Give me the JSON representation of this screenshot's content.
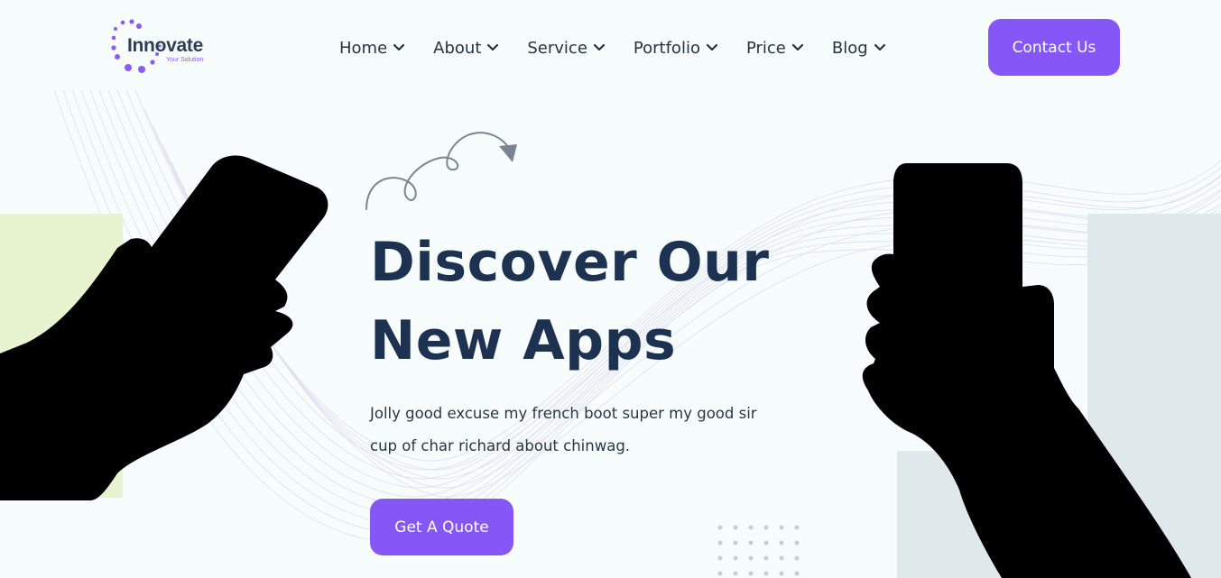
{
  "brand": {
    "name": "Innovate",
    "tagline": "Your Solution",
    "accent_color": "#8557f6"
  },
  "nav": {
    "items": [
      {
        "label": "Home",
        "icon": "chevron-down-icon"
      },
      {
        "label": "About",
        "icon": "chevron-down-icon"
      },
      {
        "label": "Service",
        "icon": "chevron-down-icon"
      },
      {
        "label": "Portfolio",
        "icon": "chevron-down-icon"
      },
      {
        "label": "Price",
        "icon": "chevron-down-icon"
      },
      {
        "label": "Blog",
        "icon": "chevron-down-icon"
      }
    ]
  },
  "header": {
    "contact_label": "Contact Us"
  },
  "hero": {
    "title_line1": "Discover Our",
    "title_line2": "New Apps",
    "description_line1": "Jolly good excuse my french boot super my good sir",
    "description_line2": "cup of char richard about chinwag.",
    "cta_label": "Get A Quote",
    "title_color": "#1d3150"
  },
  "decor": {
    "left_block_color": "#e7f4cf",
    "right_block_color": "#dfe8ea",
    "hands_color": "#000000"
  }
}
